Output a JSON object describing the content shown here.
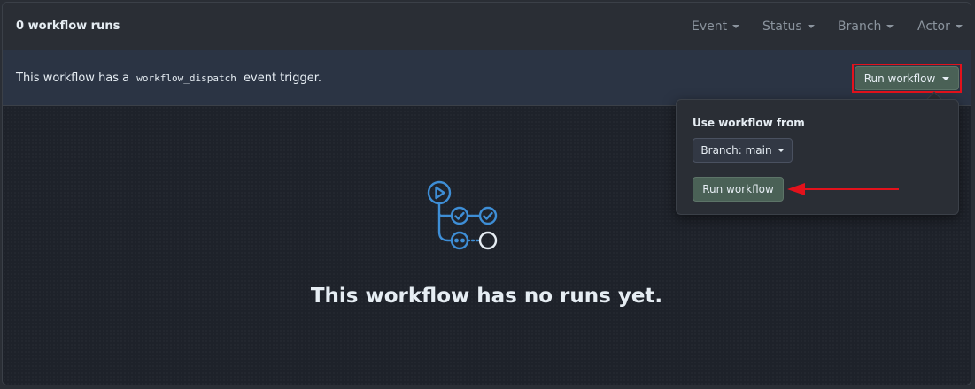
{
  "header": {
    "title": "0 workflow runs",
    "filters": [
      {
        "label": "Event"
      },
      {
        "label": "Status"
      },
      {
        "label": "Branch"
      },
      {
        "label": "Actor"
      }
    ]
  },
  "banner": {
    "text_before": "This workflow has a",
    "code": "workflow_dispatch",
    "text_after": "event trigger.",
    "run_button_label": "Run workflow"
  },
  "dropdown": {
    "title": "Use workflow from",
    "branch_label": "Branch: main",
    "run_button_label": "Run workflow"
  },
  "empty_state": {
    "title": "This workflow has no runs yet.",
    "icon": "workflow-graph-icon"
  },
  "colors": {
    "accent_blue": "#3e8ed6",
    "highlight_red": "#e3121c",
    "primary_button": "#4a6156"
  }
}
